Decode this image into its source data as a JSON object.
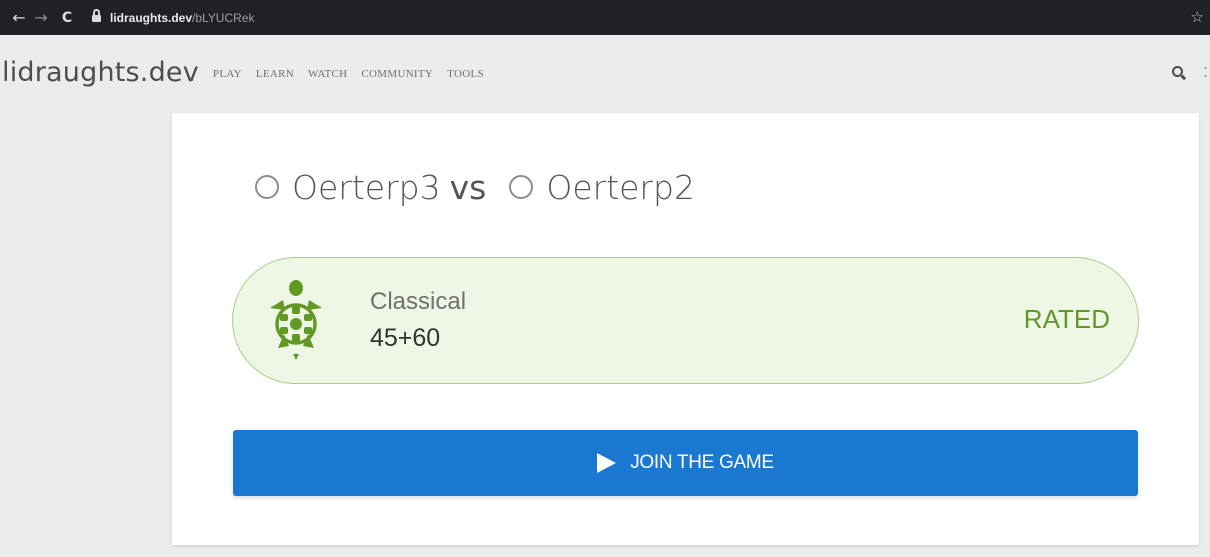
{
  "browser": {
    "back_glyph": "←",
    "forward_glyph": "→",
    "reload_glyph": "C",
    "url_host": "lidraughts.dev",
    "url_path": "/bLYUCRek",
    "bookmark_glyph": "☆"
  },
  "site": {
    "logo": "lidraughts.dev",
    "nav": [
      "PLAY",
      "LEARN",
      "WATCH",
      "COMMUNITY",
      "TOOLS"
    ],
    "more_glyph": ":"
  },
  "game": {
    "player1": "Oerterp3",
    "vs": "vs",
    "player2": "Oerterp2",
    "speed_icon": "turtle-icon",
    "speed": "Classical",
    "time_control": "45+60",
    "rated": "RATED",
    "join_label": "JOIN THE GAME"
  },
  "colors": {
    "accent_blue": "#1b78d0",
    "rated_green": "#629924",
    "info_bg": "#eef6e6"
  }
}
